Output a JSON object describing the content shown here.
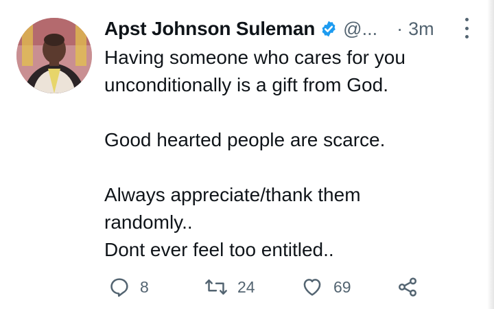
{
  "tweet": {
    "author_name": "Apst Johnson Suleman",
    "handle": "@...",
    "separator": "·",
    "timestamp": "3m",
    "lines": [
      "Having someone who cares for you",
      "unconditionally is a gift from God.",
      "",
      "Good hearted people are scarce.",
      "",
      "Always appreciate/thank them",
      "randomly..",
      "Dont ever feel too entitled.."
    ],
    "verified_icon": "verified-badge-icon",
    "accent_color": "#1d9bf0"
  },
  "actions": {
    "reply_count": "8",
    "retweet_count": "24",
    "like_count": "69",
    "icons": [
      "reply-icon",
      "retweet-icon",
      "like-icon",
      "share-icon"
    ]
  }
}
